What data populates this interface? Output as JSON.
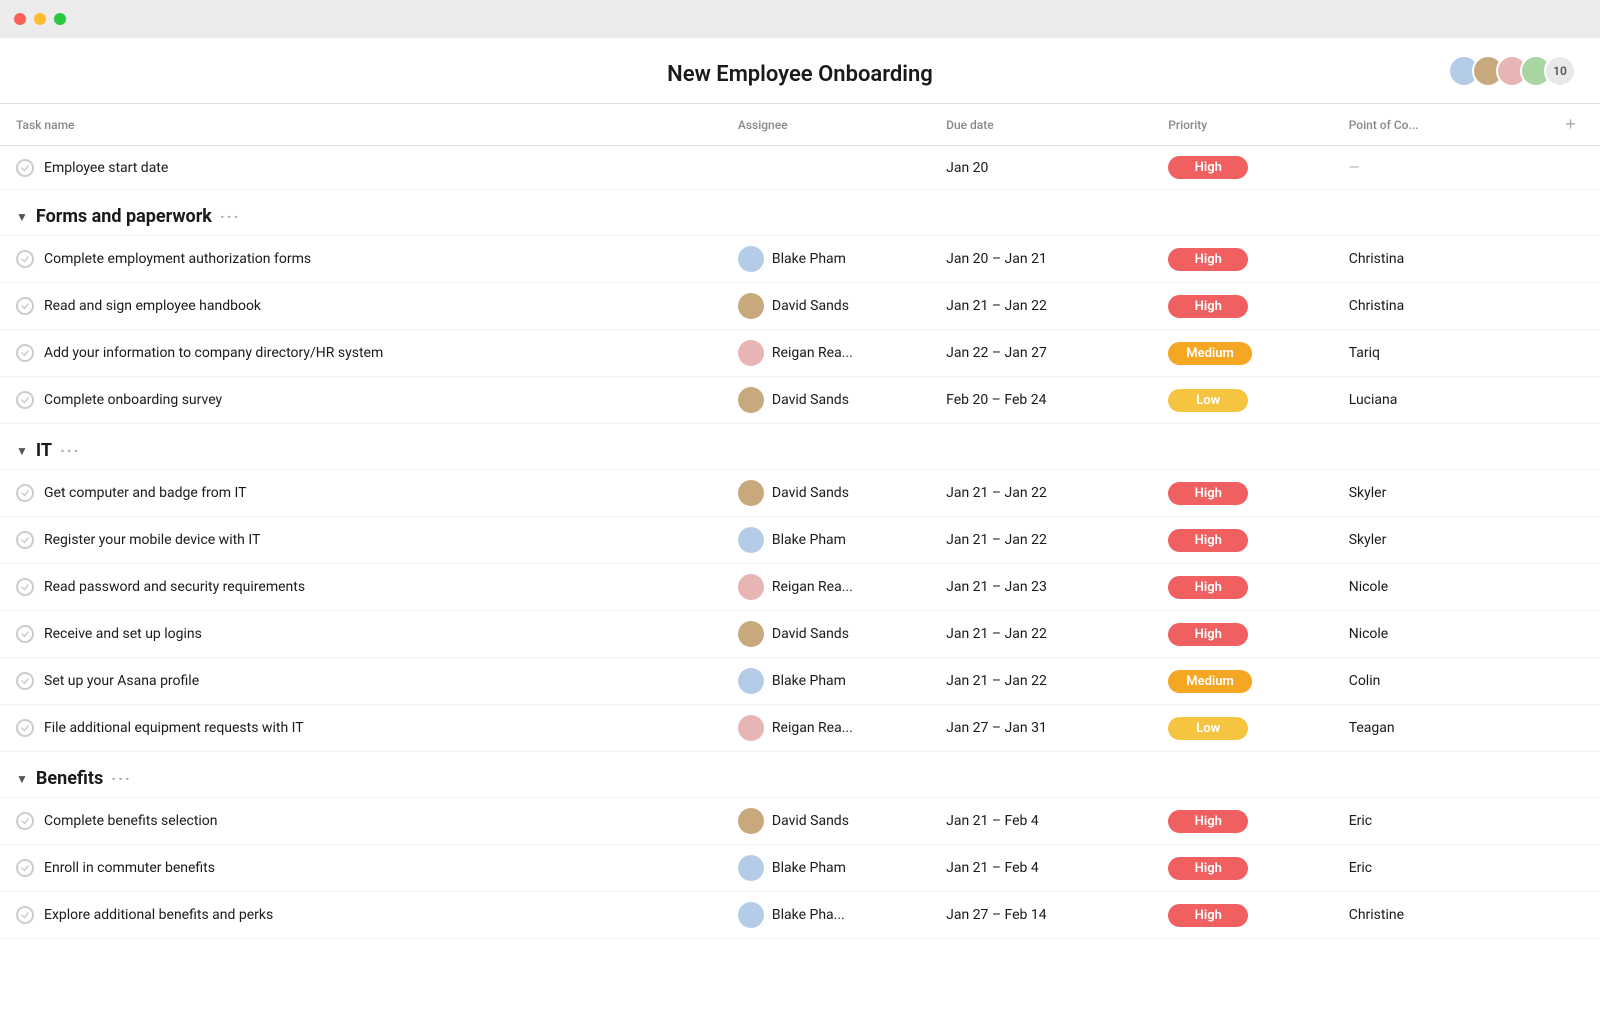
{
  "titlebar": {
    "lights": [
      "red",
      "yellow",
      "green"
    ]
  },
  "header": {
    "title": "New Employee Onboarding",
    "avatar_count": "10"
  },
  "columns": {
    "task_name": "Task name",
    "assignee": "Assignee",
    "due_date": "Due date",
    "priority": "Priority",
    "point_of_contact": "Point of Co...",
    "add_icon": "+"
  },
  "sections": [
    {
      "id": "standalone",
      "is_section": false,
      "tasks": [
        {
          "name": "Employee start date",
          "assignee": "",
          "due_date": "Jan 20",
          "priority": "High",
          "priority_level": "high",
          "poc": "—"
        }
      ]
    },
    {
      "id": "forms",
      "is_section": true,
      "title": "Forms and paperwork",
      "tasks": [
        {
          "name": "Complete employment authorization forms",
          "assignee": "Blake Pham",
          "assignee_av": "av1",
          "due_date": "Jan 20 – Jan 21",
          "priority": "High",
          "priority_level": "high",
          "poc": "Christina"
        },
        {
          "name": "Read and sign employee handbook",
          "assignee": "David Sands",
          "assignee_av": "av2",
          "due_date": "Jan 21 – Jan 22",
          "priority": "High",
          "priority_level": "high",
          "poc": "Christina"
        },
        {
          "name": "Add your information to company directory/HR system",
          "assignee": "Reigan Rea...",
          "assignee_av": "av3",
          "due_date": "Jan 22 – Jan 27",
          "priority": "Medium",
          "priority_level": "medium",
          "poc": "Tariq"
        },
        {
          "name": "Complete onboarding survey",
          "assignee": "David Sands",
          "assignee_av": "av2",
          "due_date": "Feb 20 – Feb 24",
          "priority": "Low",
          "priority_level": "low",
          "poc": "Luciana"
        }
      ]
    },
    {
      "id": "it",
      "is_section": true,
      "title": "IT",
      "tasks": [
        {
          "name": "Get computer and badge from IT",
          "assignee": "David Sands",
          "assignee_av": "av2",
          "due_date": "Jan 21 – Jan 22",
          "priority": "High",
          "priority_level": "high",
          "poc": "Skyler"
        },
        {
          "name": "Register your mobile device with IT",
          "assignee": "Blake Pham",
          "assignee_av": "av1",
          "due_date": "Jan 21 – Jan 22",
          "priority": "High",
          "priority_level": "high",
          "poc": "Skyler"
        },
        {
          "name": "Read password and security requirements",
          "assignee": "Reigan Rea...",
          "assignee_av": "av3",
          "due_date": "Jan 21 – Jan 23",
          "priority": "High",
          "priority_level": "high",
          "poc": "Nicole"
        },
        {
          "name": "Receive and set up logins",
          "assignee": "David Sands",
          "assignee_av": "av2",
          "due_date": "Jan 21 – Jan 22",
          "priority": "High",
          "priority_level": "high",
          "poc": "Nicole"
        },
        {
          "name": "Set up your Asana profile",
          "assignee": "Blake Pham",
          "assignee_av": "av1",
          "due_date": "Jan 21 – Jan 22",
          "priority": "Medium",
          "priority_level": "medium",
          "poc": "Colin"
        },
        {
          "name": "File additional equipment requests with IT",
          "assignee": "Reigan Rea...",
          "assignee_av": "av3",
          "due_date": "Jan 27 – Jan 31",
          "priority": "Low",
          "priority_level": "low",
          "poc": "Teagan"
        }
      ]
    },
    {
      "id": "benefits",
      "is_section": true,
      "title": "Benefits",
      "tasks": [
        {
          "name": "Complete benefits selection",
          "assignee": "David Sands",
          "assignee_av": "av2",
          "due_date": "Jan 21 – Feb 4",
          "priority": "High",
          "priority_level": "high",
          "poc": "Eric"
        },
        {
          "name": "Enroll in commuter benefits",
          "assignee": "Blake Pham",
          "assignee_av": "av1",
          "due_date": "Jan 21 – Feb 4",
          "priority": "High",
          "priority_level": "high",
          "poc": "Eric"
        },
        {
          "name": "Explore additional benefits and perks",
          "assignee": "Blake Pha...",
          "assignee_av": "av1",
          "due_date": "Jan 27 – Feb 14",
          "priority": "High",
          "priority_level": "high",
          "poc": "Christine"
        }
      ]
    }
  ]
}
